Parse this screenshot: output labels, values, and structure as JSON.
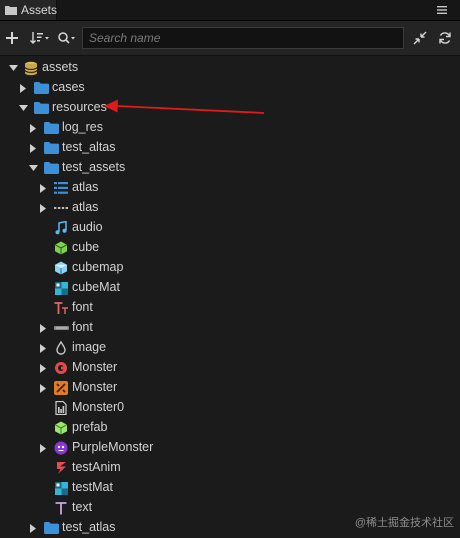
{
  "panel": {
    "tab_title": "Assets"
  },
  "toolbar": {
    "search_placeholder": "Search name"
  },
  "tree": [
    {
      "label": "assets",
      "icon": "database-icon",
      "depth": 0,
      "expanded": true
    },
    {
      "label": "cases",
      "icon": "folder-icon",
      "depth": 1,
      "expanded": false
    },
    {
      "label": "resources",
      "icon": "folder-icon",
      "depth": 1,
      "expanded": true
    },
    {
      "label": "log_res",
      "icon": "folder-icon",
      "depth": 2,
      "expanded": false
    },
    {
      "label": "test_altas",
      "icon": "folder-icon",
      "depth": 2,
      "expanded": false
    },
    {
      "label": "test_assets",
      "icon": "folder-icon",
      "depth": 2,
      "expanded": true
    },
    {
      "label": "atlas",
      "icon": "auto-atlas-icon",
      "depth": 3,
      "expanded": false
    },
    {
      "label": "atlas",
      "icon": "label-atlas-icon",
      "depth": 3,
      "expanded": false
    },
    {
      "label": "audio",
      "icon": "music-note-icon",
      "depth": 3
    },
    {
      "label": "cube",
      "icon": "cube-mesh-icon",
      "depth": 3
    },
    {
      "label": "cubemap",
      "icon": "cubemap-icon",
      "depth": 3
    },
    {
      "label": "cubeMat",
      "icon": "material-icon",
      "depth": 3
    },
    {
      "label": "font",
      "icon": "ttf-font-icon",
      "depth": 3
    },
    {
      "label": "font",
      "icon": "bitmap-font-icon",
      "depth": 3,
      "expanded": false
    },
    {
      "label": "image",
      "icon": "image-drop-icon",
      "depth": 3,
      "expanded": false
    },
    {
      "label": "Monster",
      "icon": "spine-icon",
      "depth": 3,
      "expanded": false
    },
    {
      "label": "Monster",
      "icon": "dragonbones-icon",
      "depth": 3,
      "expanded": false
    },
    {
      "label": "Monster0",
      "icon": "skeleton-data-icon",
      "depth": 3
    },
    {
      "label": "prefab",
      "icon": "prefab-icon",
      "depth": 3
    },
    {
      "label": "PurpleMonster",
      "icon": "purple-monster-icon",
      "depth": 3,
      "expanded": false
    },
    {
      "label": "testAnim",
      "icon": "animation-clip-icon",
      "depth": 3
    },
    {
      "label": "testMat",
      "icon": "material-icon",
      "depth": 3
    },
    {
      "label": "text",
      "icon": "text-asset-icon",
      "depth": 3
    },
    {
      "label": "test_atlas",
      "icon": "folder-icon",
      "depth": 2,
      "expanded": false
    }
  ],
  "annotation": {
    "color": "#e01b1b",
    "points_to": "resources"
  },
  "watermark": "@稀土掘金技术社区",
  "colors": {
    "folder": "#3d8fd8",
    "background": "#1b1b1b",
    "toolbar": "#242424"
  }
}
